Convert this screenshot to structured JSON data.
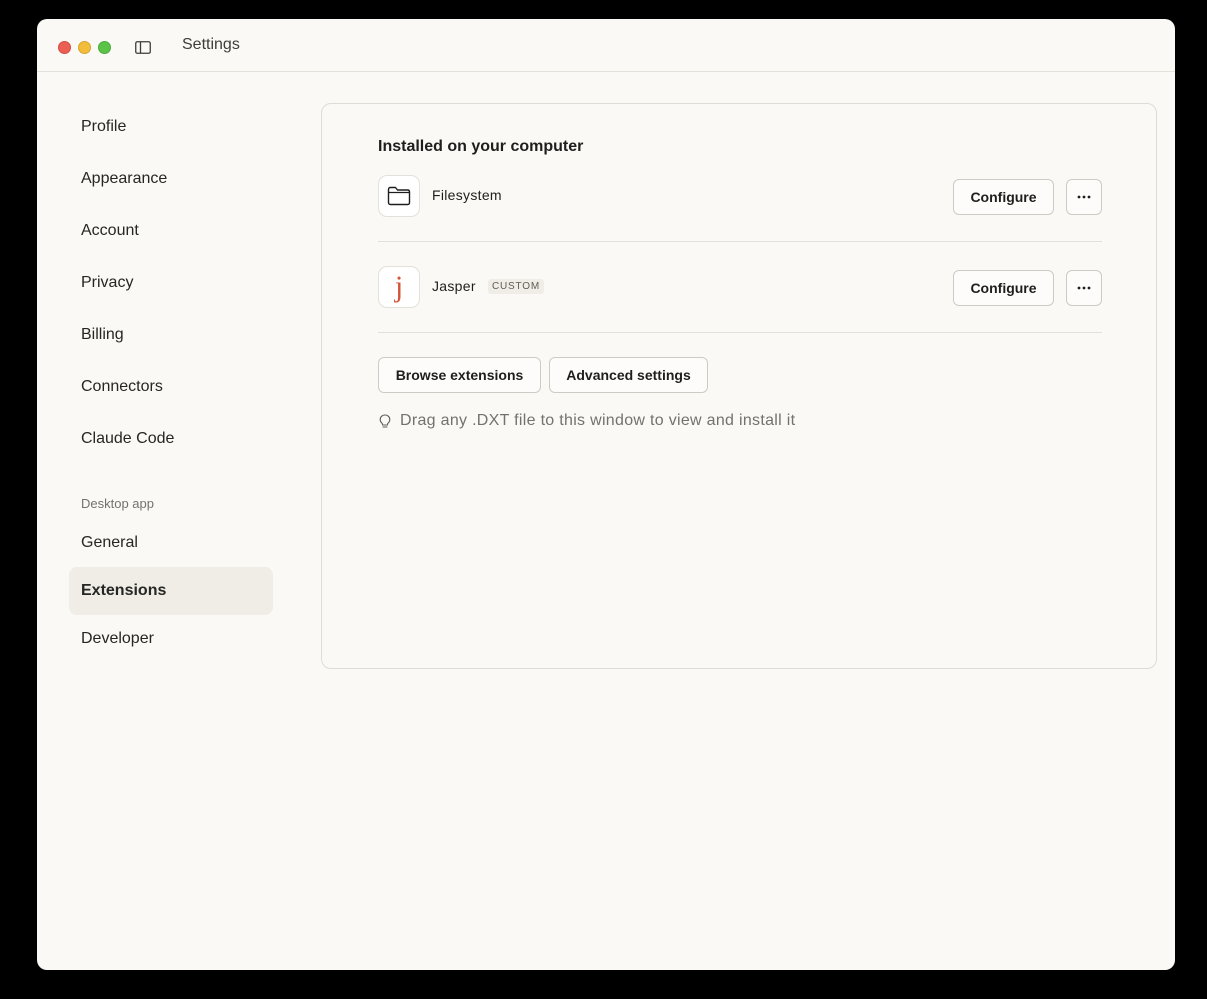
{
  "window": {
    "title": "Settings"
  },
  "sidebar": {
    "items": [
      {
        "label": "Profile"
      },
      {
        "label": "Appearance"
      },
      {
        "label": "Account"
      },
      {
        "label": "Privacy"
      },
      {
        "label": "Billing"
      },
      {
        "label": "Connectors"
      },
      {
        "label": "Claude Code"
      }
    ],
    "section_label": "Desktop app",
    "desktop_items": [
      {
        "label": "General"
      },
      {
        "label": "Extensions",
        "active": true
      },
      {
        "label": "Developer"
      }
    ]
  },
  "extensions": {
    "heading": "Installed on your computer",
    "items": [
      {
        "name": "Filesystem",
        "icon": "folder-icon",
        "configure_label": "Configure",
        "more_label": "···"
      },
      {
        "name": "Jasper",
        "icon": "letter-j",
        "icon_letter": "j",
        "badge": "CUSTOM",
        "configure_label": "Configure",
        "more_label": "···"
      }
    ],
    "browse_label": "Browse extensions",
    "advanced_label": "Advanced settings",
    "hint": "Drag any .DXT file to this window to view and install it",
    "hint_icon": "lightbulb-icon"
  },
  "colors": {
    "accent_j": "#d4543a",
    "active_bg": "#efede6",
    "window_bg": "#faf9f5"
  }
}
